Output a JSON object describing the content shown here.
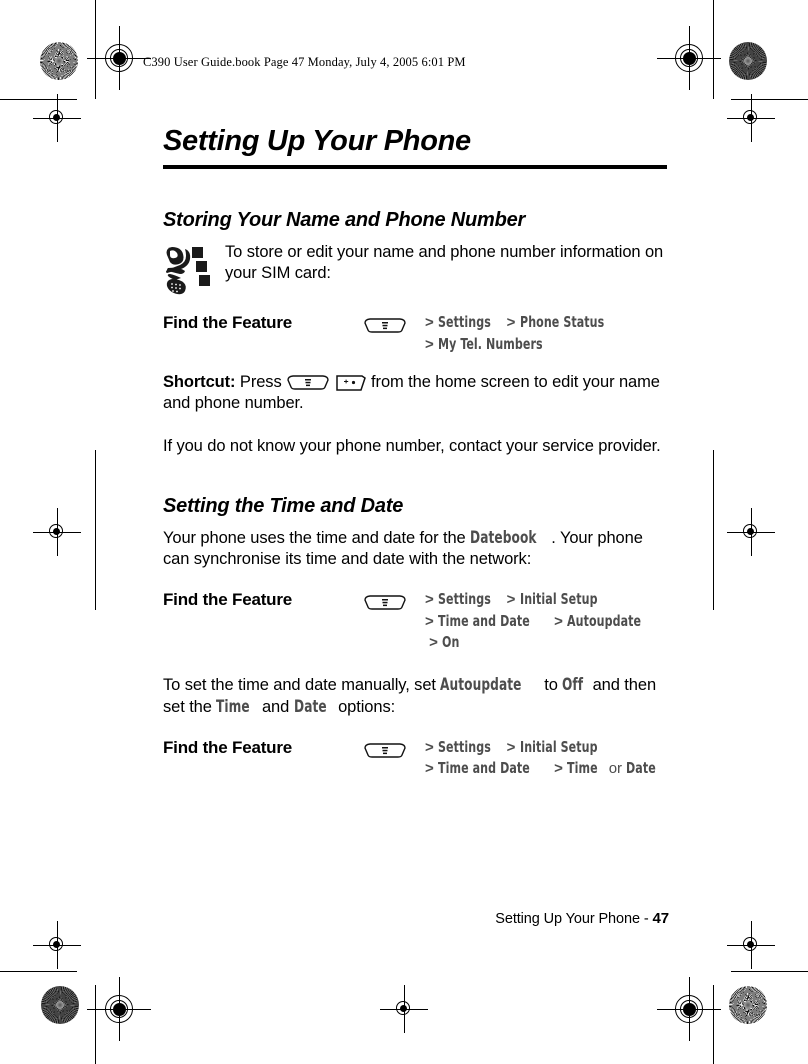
{
  "slugline": "C390 User Guide.book  Page 47  Monday, July 4, 2005  6:01 PM",
  "chapter": {
    "title": "Setting Up Your Phone"
  },
  "sections": [
    {
      "heading": "Storing Your Name and Phone Number",
      "intro": "To store or edit your name and phone number information on your SIM card:"
    },
    {
      "heading": "Setting the Time and Date"
    }
  ],
  "find_the_feature": {
    "label": "Find the Feature",
    "key_icon": "menu-key-icon"
  },
  "tables": [
    {
      "label": "Find the Feature",
      "lines": [
        [
          {
            "t": "gt",
            "v": ">"
          },
          {
            "t": "ui",
            "v": "Settings"
          },
          {
            "t": "gt",
            "v": ">"
          },
          {
            "t": "ui",
            "v": "Phone Status"
          }
        ],
        [
          {
            "t": "gt",
            "v": ">"
          },
          {
            "t": "ui",
            "v": "My Tel. Numbers"
          }
        ]
      ]
    },
    {
      "label": "Find the Feature",
      "lines": [
        [
          {
            "t": "gt",
            "v": ">"
          },
          {
            "t": "ui",
            "v": "Settings"
          },
          {
            "t": "gt",
            "v": ">"
          },
          {
            "t": "ui",
            "v": "Initial Setup"
          }
        ],
        [
          {
            "t": "gt",
            "v": ">"
          },
          {
            "t": "ui",
            "v": "Time and Date"
          },
          {
            "t": "gt",
            "v": ">"
          },
          {
            "t": "ui",
            "v": "Autoupdate"
          },
          {
            "t": "gt",
            "v": ">"
          },
          {
            "t": "ui",
            "v": "On"
          }
        ]
      ]
    },
    {
      "label": "Find the Feature",
      "lines": [
        [
          {
            "t": "gt",
            "v": ">"
          },
          {
            "t": "ui",
            "v": "Settings"
          },
          {
            "t": "gt",
            "v": ">"
          },
          {
            "t": "ui",
            "v": "Initial Setup"
          }
        ],
        [
          {
            "t": "gt",
            "v": ">"
          },
          {
            "t": "ui",
            "v": "Time and Date"
          },
          {
            "t": "gt",
            "v": ">"
          },
          {
            "t": "ui",
            "v": "Time"
          },
          {
            "t": "plain",
            "v": "or"
          },
          {
            "t": "ui",
            "v": "Date"
          }
        ]
      ]
    }
  ],
  "paragraphs": {
    "shortcut_lead": "Shortcut:",
    "shortcut_a": " Press ",
    "shortcut_b": " from the home screen to edit your name and phone number.",
    "no_number": "If you do not know your phone number, contact your service provider.",
    "time_date_a": "Your phone uses the time and date for the ",
    "time_date_term": "Datebook",
    "time_date_b": ". Your phone can synchronise its time and date with the network:",
    "manual_a": "To set the time and date manually, set ",
    "manual_term1": "Autoupdate",
    "manual_b": " to ",
    "manual_term2": "Off",
    "manual_c": " and then set the ",
    "manual_term3": "Time",
    "manual_d": " and ",
    "manual_term4": "Date",
    "manual_e": " options:"
  },
  "footer": {
    "text": "Setting Up Your Phone - ",
    "page": "47"
  },
  "colors": {
    "ui_term": "#4d4d4d",
    "text": "#000000",
    "rule": "#000000"
  }
}
